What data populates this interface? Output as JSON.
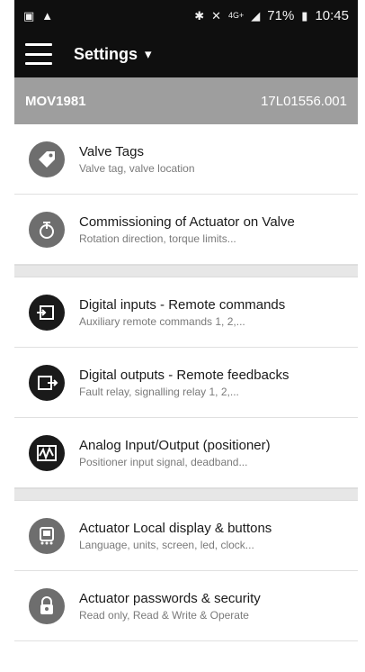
{
  "status_bar": {
    "time": "10:45",
    "battery": "71%",
    "network": "4G+",
    "icons": [
      "screenshot-icon",
      "warning-icon",
      "bluetooth-icon",
      "mute-icon",
      "signal-icon",
      "battery-icon"
    ]
  },
  "app_bar": {
    "title": "Settings"
  },
  "device": {
    "name": "MOV1981",
    "serial": "17L01556.001"
  },
  "groups": [
    [
      {
        "icon": "tag-icon",
        "title": "Valve Tags",
        "subtitle": "Valve tag, valve location"
      },
      {
        "icon": "actuator-valve-icon",
        "title": "Commissioning of Actuator on Valve",
        "subtitle": "Rotation direction, torque limits..."
      }
    ],
    [
      {
        "icon": "digital-inputs-icon",
        "title": "Digital inputs - Remote commands",
        "subtitle": "Auxiliary remote commands 1, 2,..."
      },
      {
        "icon": "digital-outputs-icon",
        "title": "Digital outputs - Remote feedbacks",
        "subtitle": "Fault relay, signalling relay 1, 2,..."
      },
      {
        "icon": "analog-io-icon",
        "title": "Analog Input/Output (positioner)",
        "subtitle": "Positioner input signal, deadband..."
      }
    ],
    [
      {
        "icon": "local-display-icon",
        "title": "Actuator Local display & buttons",
        "subtitle": "Language, units, screen, led, clock..."
      },
      {
        "icon": "lock-icon",
        "title": "Actuator passwords & security",
        "subtitle": "Read only, Read & Write & Operate"
      }
    ]
  ]
}
